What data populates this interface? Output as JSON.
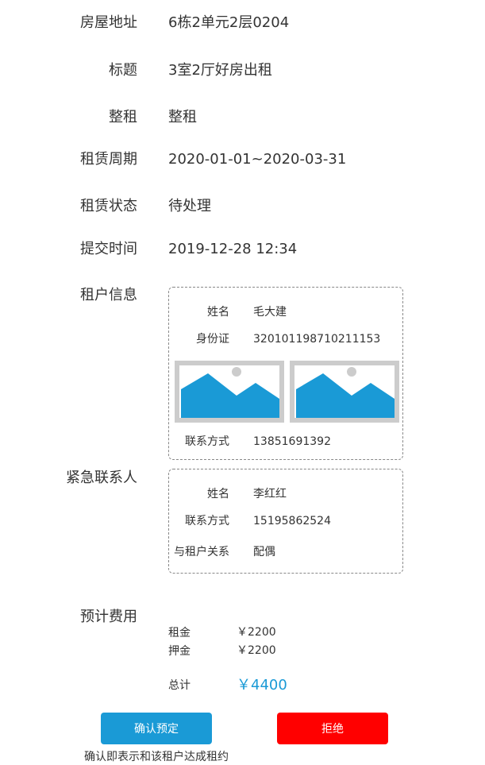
{
  "fields": [
    {
      "label": "房屋地址",
      "value": "6栋2单元2层0204"
    },
    {
      "label": "标题",
      "value": "3室2厅好房出租"
    },
    {
      "label": "整租",
      "value": "整租"
    },
    {
      "label": "租赁周期",
      "value": "2020-01-01~2020-03-31"
    },
    {
      "label": "租赁状态",
      "value": "待处理"
    },
    {
      "label": "提交时间",
      "value": "2019-12-28 12:34"
    }
  ],
  "tenant": {
    "section_label": "租户信息",
    "name_label": "姓名",
    "name": "毛大建",
    "id_label": "身份证",
    "id_number": "320101198710211153",
    "id_photos": [
      "image-placeholder-icon",
      "image-placeholder-icon"
    ],
    "phone_label": "联系方式",
    "phone": "13851691392"
  },
  "emergency_contact": {
    "section_label": "紧急联系人",
    "name_label": "姓名",
    "name": "李红红",
    "phone_label": "联系方式",
    "phone": "15195862524",
    "relation_label": "与租户关系",
    "relation": "配偶"
  },
  "fees": {
    "section_label": "预计费用",
    "rent_label": "租金",
    "rent": "￥2200",
    "deposit_label": "押金",
    "deposit": "￥2200",
    "total_label": "总计",
    "total": "￥4400",
    "total_color": "#1a9ad6"
  },
  "actions": {
    "confirm_label": "确认预定",
    "confirm_color": "#1a9ad6",
    "reject_label": "拒绝",
    "reject_color": "#ff0000",
    "note": "确认即表示和该租户达成租约"
  },
  "colors": {
    "placeholder_sky": "#1a9ad6",
    "placeholder_frame": "#cccccc"
  }
}
